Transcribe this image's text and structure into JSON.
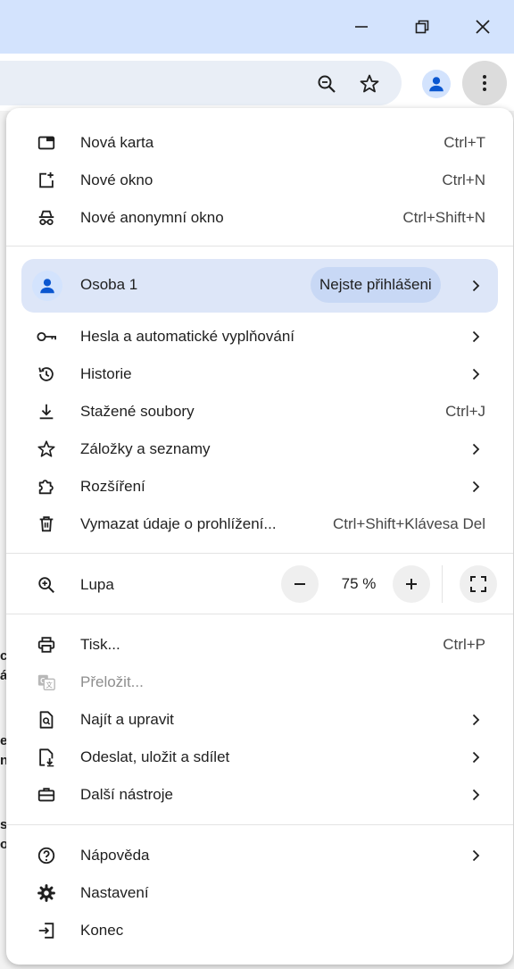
{
  "window": {
    "minimize_icon": "minimize-icon",
    "restore_icon": "restore-icon",
    "close_icon": "close-icon"
  },
  "page_fragments": [
    "ci",
    "ár",
    "e",
    "n",
    "s",
    "ol"
  ],
  "menu": {
    "group1": [
      {
        "label": "Nová karta",
        "shortcut": "Ctrl+T",
        "icon": "new-tab-icon"
      },
      {
        "label": "Nové okno",
        "shortcut": "Ctrl+N",
        "icon": "new-window-icon"
      },
      {
        "label": "Nové anonymní okno",
        "shortcut": "Ctrl+Shift+N",
        "icon": "incognito-icon"
      }
    ],
    "profile": {
      "name": "Osoba 1",
      "status": "Nejste přihlášeni"
    },
    "group2": [
      {
        "label": "Hesla a automatické vyplňování",
        "icon": "key-icon"
      },
      {
        "label": "Historie",
        "icon": "history-icon"
      },
      {
        "label": "Stažené soubory",
        "shortcut": "Ctrl+J",
        "icon": "download-icon"
      },
      {
        "label": "Záložky a seznamy",
        "icon": "star-icon"
      },
      {
        "label": "Rozšíření",
        "icon": "extension-icon"
      },
      {
        "label": "Vymazat údaje o prohlížení...",
        "shortcut": "Ctrl+Shift+Klávesa Del",
        "icon": "trash-icon"
      }
    ],
    "zoom": {
      "label": "Lupa",
      "value": "75 %",
      "minus": "−",
      "plus": "+"
    },
    "group3": [
      {
        "label": "Tisk...",
        "shortcut": "Ctrl+P",
        "icon": "print-icon"
      },
      {
        "label": "Přeložit...",
        "icon": "translate-icon",
        "disabled": true
      },
      {
        "label": "Najít a upravit",
        "icon": "find-icon"
      },
      {
        "label": "Odeslat, uložit a sdílet",
        "icon": "save-share-icon"
      },
      {
        "label": "Další nástroje",
        "icon": "toolbox-icon"
      }
    ],
    "group4": [
      {
        "label": "Nápověda",
        "icon": "help-icon"
      },
      {
        "label": "Nastavení",
        "icon": "gear-icon"
      },
      {
        "label": "Konec",
        "icon": "exit-icon"
      }
    ]
  }
}
